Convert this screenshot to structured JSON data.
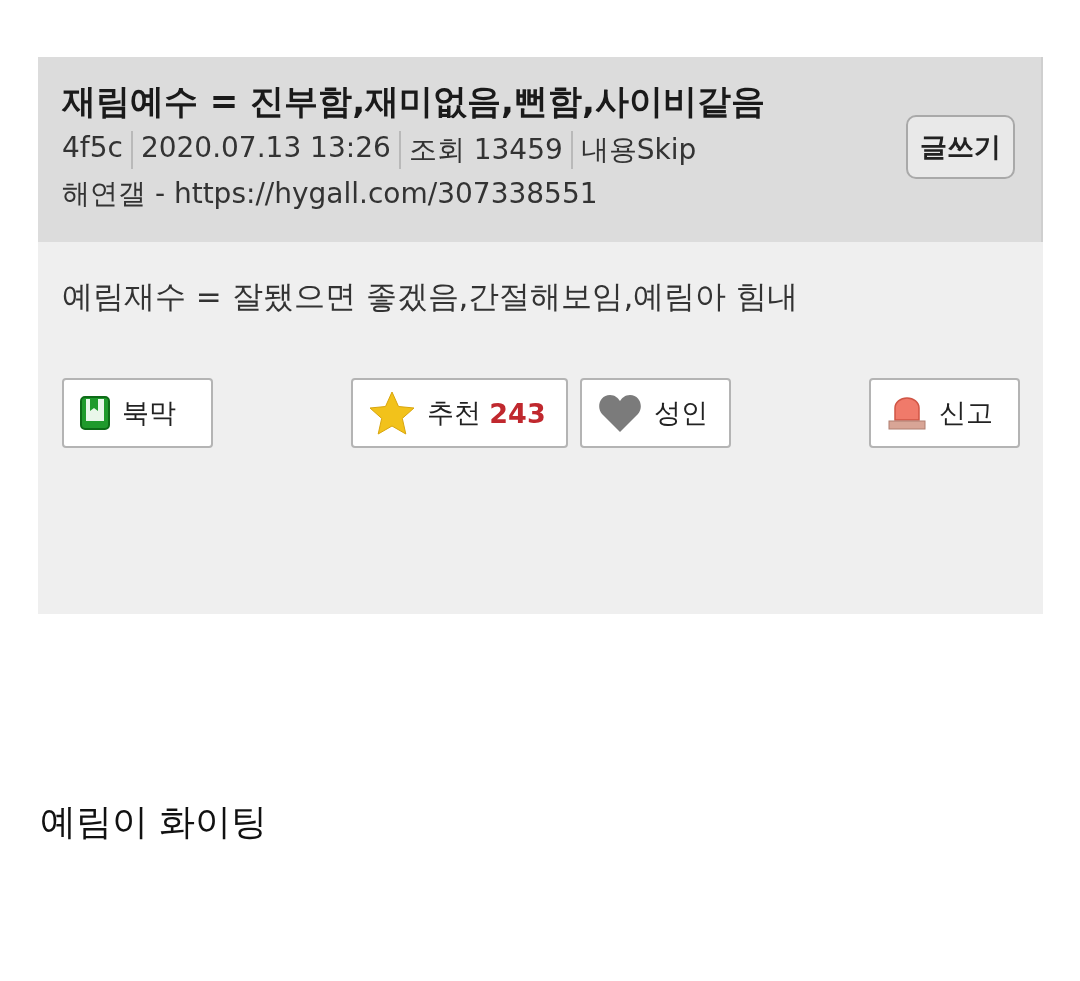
{
  "post": {
    "title": "재림예수 = 진부함,재미없음,뻔함,사이비같음",
    "meta": [
      "4f5c",
      "2020.07.13 13:26",
      "조회 13459",
      "내용Skip"
    ],
    "source": "해연갤 - https://hygall.com/307338551",
    "write_button": "글쓰기",
    "body": "예림재수 = 잘됐으면 좋겠음,간절해보임,예림아 힘내",
    "buttons": [
      {
        "kind": "bookmark",
        "label": "북막"
      },
      {
        "kind": "recommend",
        "label": "추천",
        "count": "243"
      },
      {
        "kind": "adult",
        "label": "성인"
      },
      {
        "kind": "report",
        "label": "신고"
      }
    ]
  },
  "caption": "예림이 화이팅"
}
